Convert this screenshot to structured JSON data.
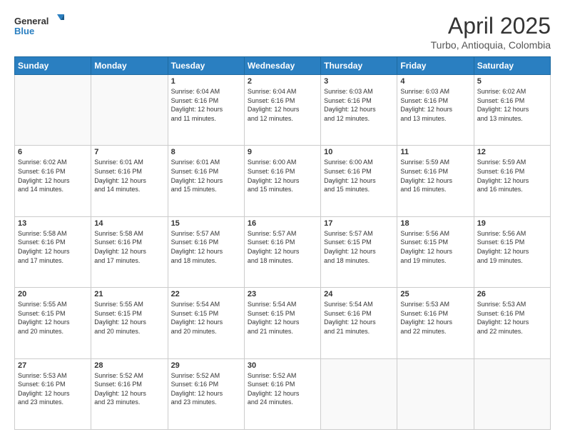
{
  "header": {
    "logo_line1": "General",
    "logo_line2": "Blue",
    "month": "April 2025",
    "location": "Turbo, Antioquia, Colombia"
  },
  "days_of_week": [
    "Sunday",
    "Monday",
    "Tuesday",
    "Wednesday",
    "Thursday",
    "Friday",
    "Saturday"
  ],
  "weeks": [
    [
      {
        "day": "",
        "info": ""
      },
      {
        "day": "",
        "info": ""
      },
      {
        "day": "1",
        "info": "Sunrise: 6:04 AM\nSunset: 6:16 PM\nDaylight: 12 hours\nand 11 minutes."
      },
      {
        "day": "2",
        "info": "Sunrise: 6:04 AM\nSunset: 6:16 PM\nDaylight: 12 hours\nand 12 minutes."
      },
      {
        "day": "3",
        "info": "Sunrise: 6:03 AM\nSunset: 6:16 PM\nDaylight: 12 hours\nand 12 minutes."
      },
      {
        "day": "4",
        "info": "Sunrise: 6:03 AM\nSunset: 6:16 PM\nDaylight: 12 hours\nand 13 minutes."
      },
      {
        "day": "5",
        "info": "Sunrise: 6:02 AM\nSunset: 6:16 PM\nDaylight: 12 hours\nand 13 minutes."
      }
    ],
    [
      {
        "day": "6",
        "info": "Sunrise: 6:02 AM\nSunset: 6:16 PM\nDaylight: 12 hours\nand 14 minutes."
      },
      {
        "day": "7",
        "info": "Sunrise: 6:01 AM\nSunset: 6:16 PM\nDaylight: 12 hours\nand 14 minutes."
      },
      {
        "day": "8",
        "info": "Sunrise: 6:01 AM\nSunset: 6:16 PM\nDaylight: 12 hours\nand 15 minutes."
      },
      {
        "day": "9",
        "info": "Sunrise: 6:00 AM\nSunset: 6:16 PM\nDaylight: 12 hours\nand 15 minutes."
      },
      {
        "day": "10",
        "info": "Sunrise: 6:00 AM\nSunset: 6:16 PM\nDaylight: 12 hours\nand 15 minutes."
      },
      {
        "day": "11",
        "info": "Sunrise: 5:59 AM\nSunset: 6:16 PM\nDaylight: 12 hours\nand 16 minutes."
      },
      {
        "day": "12",
        "info": "Sunrise: 5:59 AM\nSunset: 6:16 PM\nDaylight: 12 hours\nand 16 minutes."
      }
    ],
    [
      {
        "day": "13",
        "info": "Sunrise: 5:58 AM\nSunset: 6:16 PM\nDaylight: 12 hours\nand 17 minutes."
      },
      {
        "day": "14",
        "info": "Sunrise: 5:58 AM\nSunset: 6:16 PM\nDaylight: 12 hours\nand 17 minutes."
      },
      {
        "day": "15",
        "info": "Sunrise: 5:57 AM\nSunset: 6:16 PM\nDaylight: 12 hours\nand 18 minutes."
      },
      {
        "day": "16",
        "info": "Sunrise: 5:57 AM\nSunset: 6:16 PM\nDaylight: 12 hours\nand 18 minutes."
      },
      {
        "day": "17",
        "info": "Sunrise: 5:57 AM\nSunset: 6:15 PM\nDaylight: 12 hours\nand 18 minutes."
      },
      {
        "day": "18",
        "info": "Sunrise: 5:56 AM\nSunset: 6:15 PM\nDaylight: 12 hours\nand 19 minutes."
      },
      {
        "day": "19",
        "info": "Sunrise: 5:56 AM\nSunset: 6:15 PM\nDaylight: 12 hours\nand 19 minutes."
      }
    ],
    [
      {
        "day": "20",
        "info": "Sunrise: 5:55 AM\nSunset: 6:15 PM\nDaylight: 12 hours\nand 20 minutes."
      },
      {
        "day": "21",
        "info": "Sunrise: 5:55 AM\nSunset: 6:15 PM\nDaylight: 12 hours\nand 20 minutes."
      },
      {
        "day": "22",
        "info": "Sunrise: 5:54 AM\nSunset: 6:15 PM\nDaylight: 12 hours\nand 20 minutes."
      },
      {
        "day": "23",
        "info": "Sunrise: 5:54 AM\nSunset: 6:15 PM\nDaylight: 12 hours\nand 21 minutes."
      },
      {
        "day": "24",
        "info": "Sunrise: 5:54 AM\nSunset: 6:16 PM\nDaylight: 12 hours\nand 21 minutes."
      },
      {
        "day": "25",
        "info": "Sunrise: 5:53 AM\nSunset: 6:16 PM\nDaylight: 12 hours\nand 22 minutes."
      },
      {
        "day": "26",
        "info": "Sunrise: 5:53 AM\nSunset: 6:16 PM\nDaylight: 12 hours\nand 22 minutes."
      }
    ],
    [
      {
        "day": "27",
        "info": "Sunrise: 5:53 AM\nSunset: 6:16 PM\nDaylight: 12 hours\nand 23 minutes."
      },
      {
        "day": "28",
        "info": "Sunrise: 5:52 AM\nSunset: 6:16 PM\nDaylight: 12 hours\nand 23 minutes."
      },
      {
        "day": "29",
        "info": "Sunrise: 5:52 AM\nSunset: 6:16 PM\nDaylight: 12 hours\nand 23 minutes."
      },
      {
        "day": "30",
        "info": "Sunrise: 5:52 AM\nSunset: 6:16 PM\nDaylight: 12 hours\nand 24 minutes."
      },
      {
        "day": "",
        "info": ""
      },
      {
        "day": "",
        "info": ""
      },
      {
        "day": "",
        "info": ""
      }
    ]
  ]
}
